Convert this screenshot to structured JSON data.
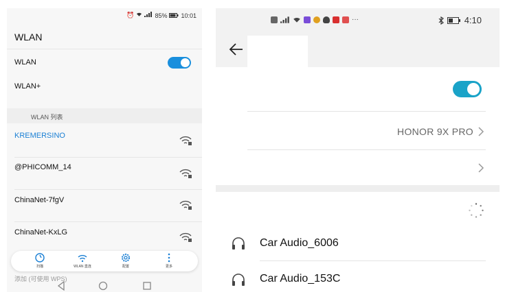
{
  "left": {
    "status": {
      "battery": "85%",
      "time": "10:01"
    },
    "title": "WLAN",
    "wlan_label": "WLAN",
    "wlan_toggle_on": true,
    "wlan_plus_label": "WLAN+",
    "section_label": "WLAN 列表",
    "networks": [
      {
        "ssid": "KREMERSINO",
        "connected": true
      },
      {
        "ssid": "@PHICOMM_14",
        "connected": false
      },
      {
        "ssid": "ChinaNet-7fgV",
        "connected": false
      },
      {
        "ssid": "ChinaNet-KxLG",
        "connected": false
      }
    ],
    "bottom_actions": [
      {
        "label": "扫描",
        "icon": "refresh-icon"
      },
      {
        "label": "WLAN 直连",
        "icon": "wifi-direct-icon"
      },
      {
        "label": "配置",
        "icon": "gear-icon"
      },
      {
        "label": "更多",
        "icon": "more-vertical-icon"
      }
    ],
    "ghost_text": "添加 (可使用 WPS)",
    "accent_color": "#1a8fdd"
  },
  "right": {
    "status": {
      "time": "4:10"
    },
    "bluetooth_toggle_on": true,
    "device_name": "HONOR 9X PRO",
    "available_devices": [
      {
        "name": "Car Audio_6006",
        "icon": "headphones-icon"
      },
      {
        "name": "Car Audio_153C",
        "icon": "headphones-icon"
      }
    ],
    "accent_color": "#1aa3c8"
  }
}
